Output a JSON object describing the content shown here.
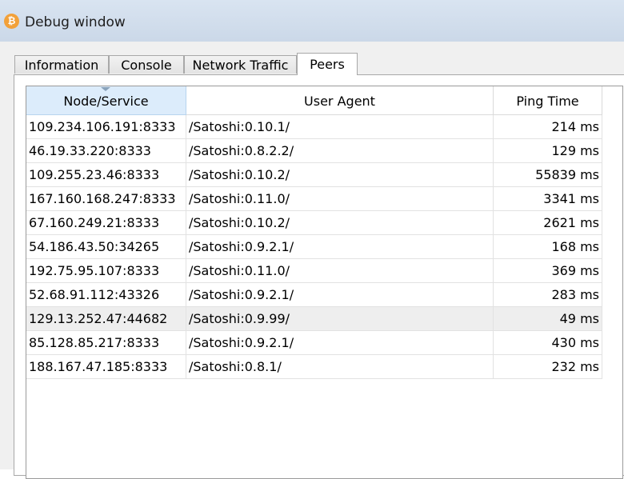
{
  "window": {
    "title": "Debug window",
    "icon": "bitcoin-icon",
    "icon_glyph": "₿"
  },
  "tabs": [
    {
      "label": "Information",
      "active": false
    },
    {
      "label": "Console",
      "active": false
    },
    {
      "label": "Network Traffic",
      "active": false
    },
    {
      "label": "Peers",
      "active": true
    }
  ],
  "peers_table": {
    "columns": [
      "Node/Service",
      "User Agent",
      "Ping Time"
    ],
    "sorted_column": "Node/Service",
    "highlighted_row": 8,
    "rows": [
      [
        "109.234.106.191:8333",
        "/Satoshi:0.10.1/",
        "214 ms"
      ],
      [
        "46.19.33.220:8333",
        "/Satoshi:0.8.2.2/",
        "129 ms"
      ],
      [
        "109.255.23.46:8333",
        "/Satoshi:0.10.2/",
        "55839 ms"
      ],
      [
        "167.160.168.247:8333",
        "/Satoshi:0.11.0/",
        "3341 ms"
      ],
      [
        "67.160.249.21:8333",
        "/Satoshi:0.10.2/",
        "2621 ms"
      ],
      [
        "54.186.43.50:34265",
        "/Satoshi:0.9.2.1/",
        "168 ms"
      ],
      [
        "192.75.95.107:8333",
        "/Satoshi:0.11.0/",
        "369 ms"
      ],
      [
        "52.68.91.112:43326",
        "/Satoshi:0.9.2.1/",
        "283 ms"
      ],
      [
        "129.13.252.47:44682",
        "/Satoshi:0.9.99/",
        "49 ms"
      ],
      [
        "85.128.85.217:8333",
        "/Satoshi:0.9.2.1/",
        "430 ms"
      ],
      [
        "188.167.47.185:8333",
        "/Satoshi:0.8.1/",
        "232 ms"
      ]
    ]
  }
}
